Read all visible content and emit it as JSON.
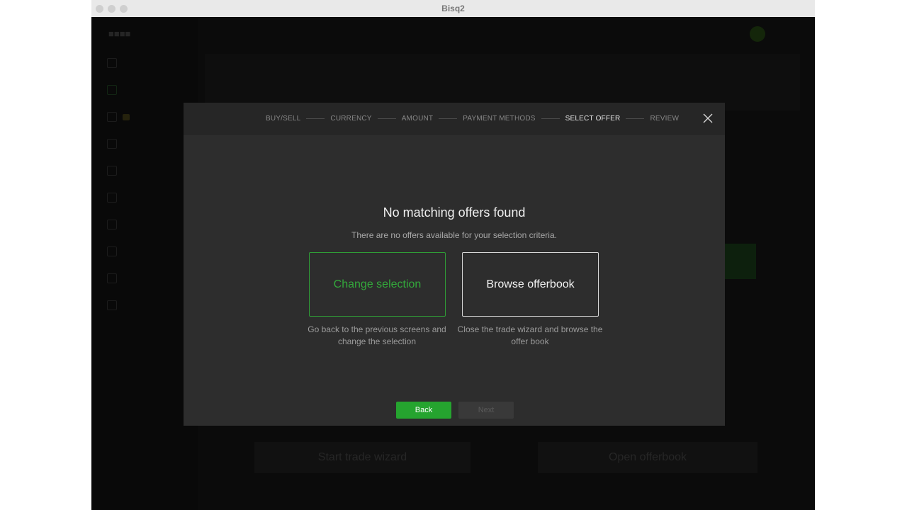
{
  "window": {
    "title": "Bisq2"
  },
  "wizard": {
    "steps": [
      {
        "label": "BUY/SELL",
        "active": false
      },
      {
        "label": "CURRENCY",
        "active": false
      },
      {
        "label": "AMOUNT",
        "active": false
      },
      {
        "label": "PAYMENT METHODS",
        "active": false
      },
      {
        "label": "SELECT OFFER",
        "active": true
      },
      {
        "label": "REVIEW",
        "active": false
      }
    ],
    "headline": "No matching offers found",
    "subline": "There are no offers available for your selection criteria.",
    "options": {
      "change": {
        "title": "Change selection",
        "description": "Go back to the previous screens and change the selection"
      },
      "browse": {
        "title": "Browse offerbook",
        "description": "Close the trade wizard and browse the offer book"
      }
    },
    "buttons": {
      "back": "Back",
      "next": "Next"
    }
  },
  "background": {
    "start_trade_wizard": "Start trade wizard",
    "open_offerbook": "Open offerbook"
  },
  "colors": {
    "accent_green": "#25a42f",
    "modal_bg": "#2d2d2d",
    "header_bg": "#262626"
  },
  "icons": {
    "close": "close-icon"
  }
}
